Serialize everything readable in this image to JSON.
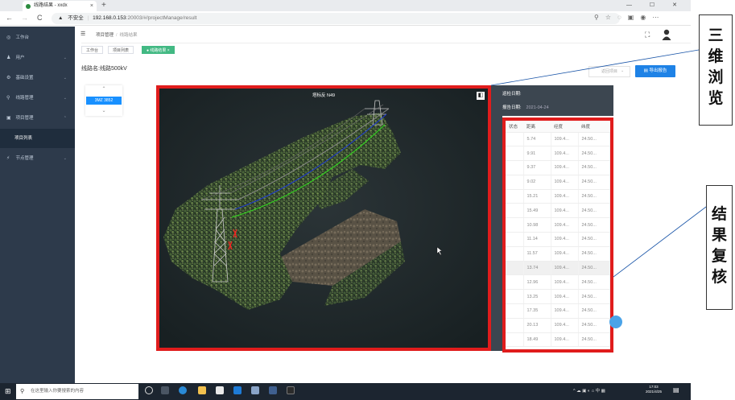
{
  "browser": {
    "tab_title": "线路结果 - xxdx",
    "new_tab": "+",
    "window_controls": "— ☐ ✕",
    "security_label": "不安全",
    "url_host": "192.168.0.153",
    "url_path": ":20003/#/projectManage/result",
    "back": "←",
    "forward": "→",
    "reload": "C"
  },
  "sidebar": {
    "items": [
      {
        "icon": "◎",
        "label": "工作台",
        "chevron": ""
      },
      {
        "icon": "♟",
        "label": "用户",
        "chevron": "⌄"
      },
      {
        "icon": "⚙",
        "label": "基础设置",
        "chevron": "⌄"
      },
      {
        "icon": "⚲",
        "label": "线路管理",
        "chevron": "⌄"
      },
      {
        "icon": "▣",
        "label": "项目管理",
        "chevron": "⌃"
      },
      {
        "icon": "",
        "label": "项目列表",
        "chevron": ""
      },
      {
        "icon": "⚡",
        "label": "节点管理",
        "chevron": "⌄"
      }
    ]
  },
  "header": {
    "menu_icon": "☰",
    "breadcrumb": [
      "项目管理",
      "线路结果"
    ],
    "fullscreen_icon": "⛶"
  },
  "tags": [
    {
      "label": "工作台"
    },
    {
      "label": "项目列表"
    },
    {
      "label": "● 线路结果 ×"
    }
  ],
  "line_name": "线路名:线路500kV",
  "tower": {
    "up": "⌃",
    "label": "3MZ 3852",
    "down": "⌄"
  },
  "buttons": {
    "time": "返回项目",
    "export": "导出报告"
  },
  "viewer": {
    "title": "塔标反 N49",
    "expand_icon": "◧"
  },
  "result": {
    "inspection_date_label": "巡检日期:",
    "inspection_date_value": "",
    "report_date_label": "报告日期:",
    "report_date_value": "2021-04-24",
    "columns": [
      "状态",
      "距离",
      "经度",
      "纬度"
    ],
    "rows": [
      [
        "",
        "5.74",
        "109.4...",
        "24.50..."
      ],
      [
        "",
        "9.91",
        "109.4...",
        "24.50..."
      ],
      [
        "",
        "9.37",
        "109.4...",
        "24.50..."
      ],
      [
        "",
        "9.02",
        "109.4...",
        "24.50..."
      ],
      [
        "",
        "15.21",
        "109.4...",
        "24.50..."
      ],
      [
        "",
        "15.49",
        "109.4...",
        "24.50..."
      ],
      [
        "",
        "10.98",
        "109.4...",
        "24.50..."
      ],
      [
        "",
        "11.14",
        "109.4...",
        "24.50..."
      ],
      [
        "",
        "11.57",
        "109.4...",
        "24.50..."
      ],
      [
        "",
        "13.74",
        "109.4...",
        "24.50..."
      ],
      [
        "",
        "12.96",
        "109.4...",
        "24.50..."
      ],
      [
        "",
        "13.25",
        "109.4...",
        "24.50..."
      ],
      [
        "",
        "17.35",
        "109.4...",
        "24.50..."
      ],
      [
        "",
        "20.13",
        "109.4...",
        "24.50..."
      ],
      [
        "",
        "18.49",
        "109.4...",
        "24.50..."
      ]
    ],
    "highlight_row": 9
  },
  "callouts": {
    "top": [
      "三",
      "维",
      "浏",
      "览"
    ],
    "bottom": [
      "结",
      "果",
      "复",
      "核"
    ]
  },
  "taskbar": {
    "start_icon": "⊞",
    "search_placeholder": "在这里输入你要搜索的内容",
    "tray": "^ ☁ ▣ ◐ ⌂ 中 ▦",
    "clock_time": "17:03",
    "clock_date": "2021/4/25",
    "notif_icon": "▤"
  },
  "colors": {
    "sidebar_bg": "#2d3a4b",
    "highlight_red": "#e01c1c",
    "primary_blue": "#1e82e6",
    "tag_green": "#42b983"
  }
}
